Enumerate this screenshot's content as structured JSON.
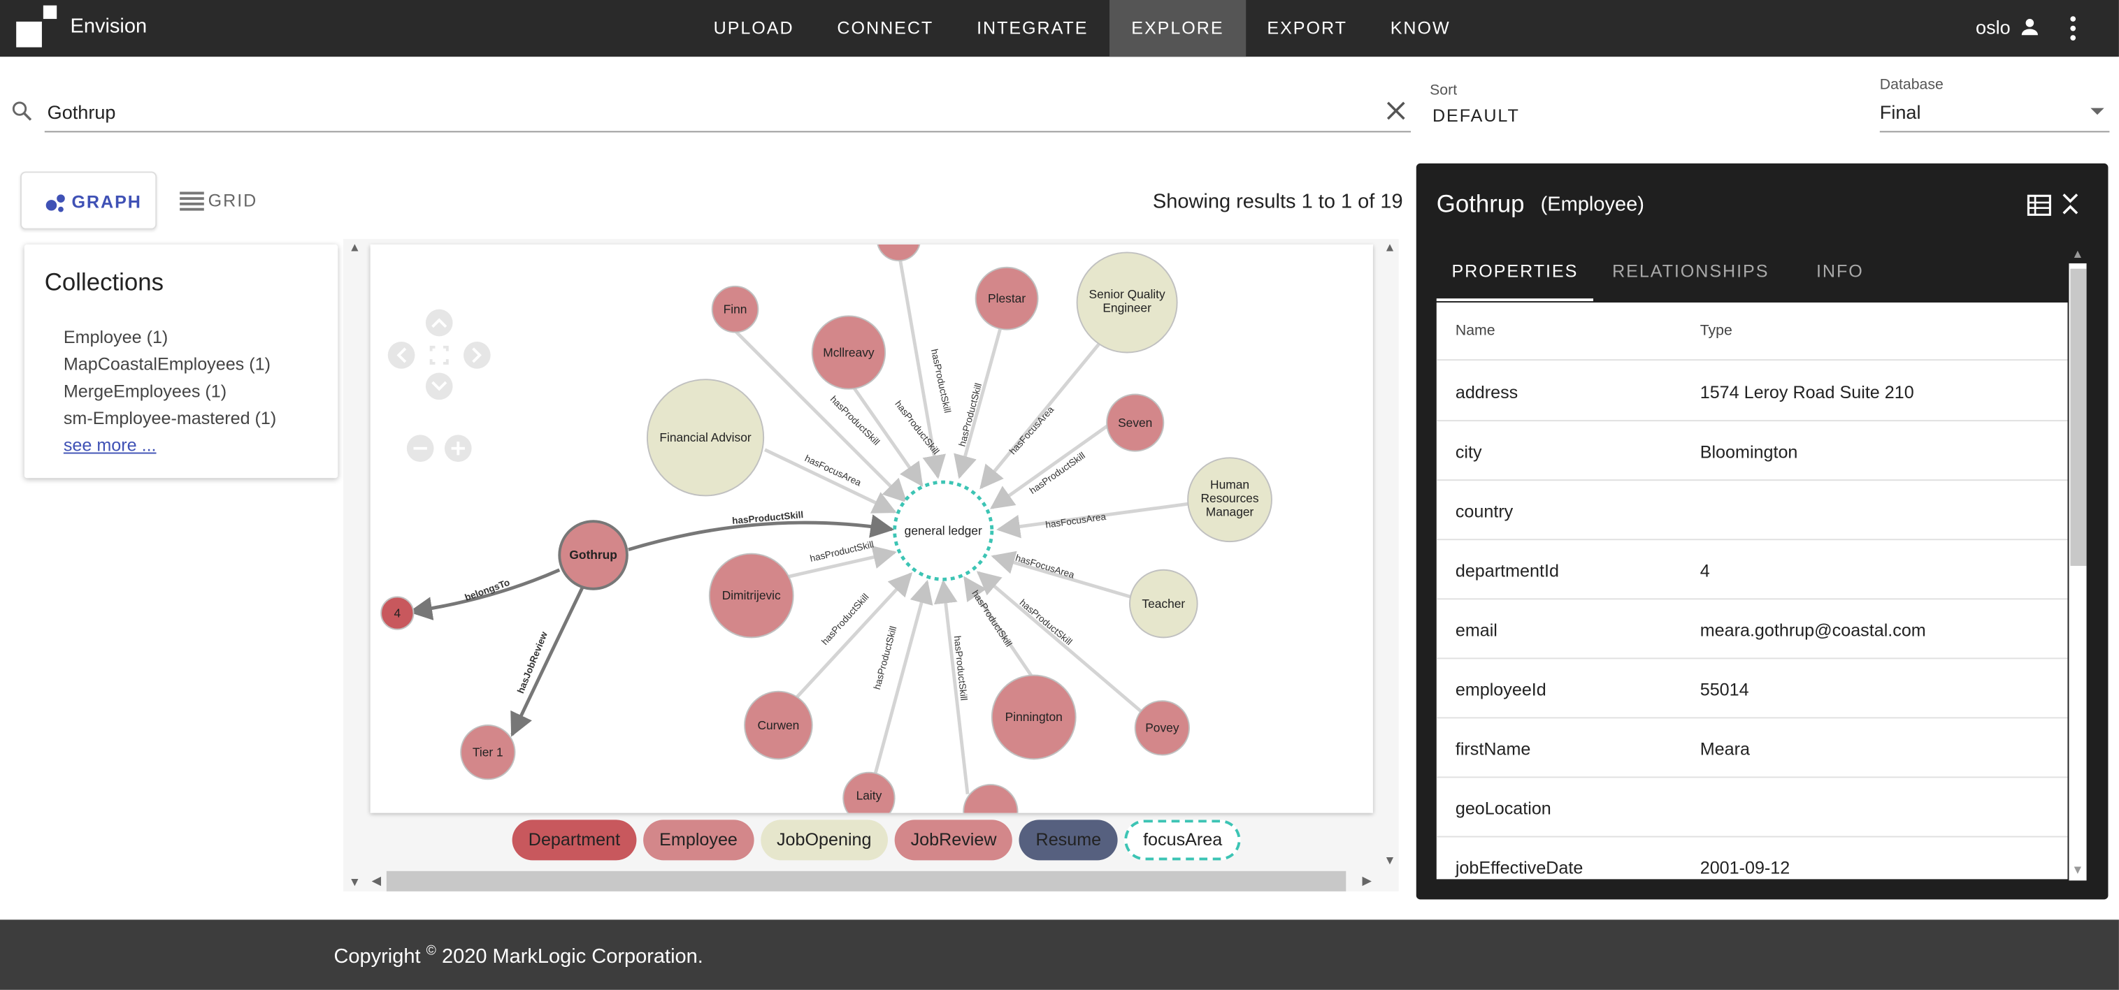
{
  "app": {
    "name": "Envision"
  },
  "nav": [
    "UPLOAD",
    "CONNECT",
    "INTEGRATE",
    "EXPLORE",
    "EXPORT",
    "KNOW"
  ],
  "nav_active": "EXPLORE",
  "user": {
    "name": "oslo"
  },
  "search": {
    "value": "Gothrup"
  },
  "sort": {
    "label": "Sort",
    "value": "DEFAULT"
  },
  "database": {
    "label": "Database",
    "value": "Final"
  },
  "views": {
    "graph": "GRAPH",
    "grid": "GRID"
  },
  "results_text": "Showing results 1 to 1 of 19",
  "collections": {
    "title": "Collections",
    "items": [
      "Employee (1)",
      "MapCoastalEmployees (1)",
      "MergeEmployees (1)",
      "sm-Employee-mastered (1)"
    ],
    "see_more": "see more ..."
  },
  "graph": {
    "center": {
      "label": "general ledger"
    },
    "nodes": [
      "Finn",
      "Mcllreavy",
      "Plestar",
      "Senior Quality Engineer",
      "Seven",
      "Human Resources Manager",
      "Teacher",
      "Povey",
      "Pinnington",
      "Curwen",
      "Dimitrijevic",
      "Financial Advisor",
      "Gothrup",
      "4",
      "Tier 1",
      "Laity"
    ],
    "edge_labels": [
      "hasProductSkill",
      "hasFocusArea",
      "belongsTo",
      "hasJobReview"
    ]
  },
  "legend": [
    {
      "label": "Department",
      "color": "#c8585d"
    },
    {
      "label": "Employee",
      "color": "#d3878a"
    },
    {
      "label": "JobOpening",
      "color": "#e6e6cc"
    },
    {
      "label": "JobReview",
      "color": "#d3878a"
    },
    {
      "label": "Resume",
      "color": "#56607f"
    },
    {
      "label": "focusArea",
      "color": "#ffffff"
    }
  ],
  "detail": {
    "title": "Gothrup",
    "subtitle": "(Employee)",
    "tabs": [
      "PROPERTIES",
      "RELATIONSHIPS",
      "INFO"
    ],
    "columns": [
      "Name",
      "Type"
    ],
    "properties": [
      {
        "name": "address",
        "value": "1574 Leroy Road Suite 210"
      },
      {
        "name": "city",
        "value": "Bloomington"
      },
      {
        "name": "country",
        "value": ""
      },
      {
        "name": "departmentId",
        "value": "4"
      },
      {
        "name": "email",
        "value": "meara.gothrup@coastal.com"
      },
      {
        "name": "employeeId",
        "value": "55014"
      },
      {
        "name": "firstName",
        "value": "Meara"
      },
      {
        "name": "geoLocation",
        "value": ""
      },
      {
        "name": "jobEffectiveDate",
        "value": "2001-09-12"
      }
    ]
  },
  "footer": {
    "copyright_pre": "Copyright",
    "copyright_sym": "©",
    "copyright_post": "2020 MarkLogic Corporation."
  }
}
